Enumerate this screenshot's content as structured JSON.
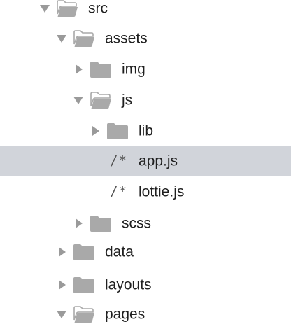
{
  "tree": {
    "src": {
      "label": "src",
      "state": "expanded",
      "icon": "folder-open-icon"
    },
    "assets": {
      "label": "assets",
      "state": "expanded",
      "icon": "folder-open-icon"
    },
    "img": {
      "label": "img",
      "state": "collapsed",
      "icon": "folder-icon"
    },
    "js": {
      "label": "js",
      "state": "expanded",
      "icon": "folder-open-icon"
    },
    "lib": {
      "label": "lib",
      "state": "collapsed",
      "icon": "folder-icon"
    },
    "app_js": {
      "label": "app.js",
      "icon_text": "/*",
      "selected": true
    },
    "lottie_js": {
      "label": "lottie.js",
      "icon_text": "/*",
      "selected": false
    },
    "scss": {
      "label": "scss",
      "state": "collapsed",
      "icon": "folder-icon"
    },
    "data": {
      "label": "data",
      "state": "collapsed",
      "icon": "folder-icon"
    },
    "layouts": {
      "label": "layouts",
      "state": "collapsed",
      "icon": "folder-icon"
    },
    "pages": {
      "label": "pages",
      "state": "expanded",
      "icon": "folder-open-icon"
    }
  },
  "colors": {
    "selection": "#d1d4da",
    "chevron": "#9a9a9a",
    "folder": "#a9a9a9",
    "text": "#1f1f1f"
  }
}
